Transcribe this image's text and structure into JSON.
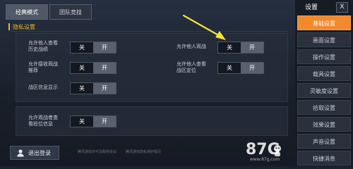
{
  "mode_tabs": [
    {
      "label": "经典模式",
      "active": true
    },
    {
      "label": "团队竞技",
      "active": false
    }
  ],
  "section": {
    "title": "隐私设置"
  },
  "options": [
    {
      "label_lines": [
        "允许他人查看",
        "历史战绩"
      ],
      "off": "关",
      "on": "开",
      "selected": "off"
    },
    {
      "label_lines": [
        "允许他人观战"
      ],
      "off": "关",
      "on": "开",
      "selected": "off"
    },
    {
      "label_lines": [
        "允许接收观战",
        "推荐"
      ],
      "off": "关",
      "on": "开",
      "selected": "off"
    },
    {
      "label_lines": [
        "允许他人查看",
        "战区定位"
      ],
      "off": "关",
      "on": "开",
      "selected": "off"
    },
    {
      "label_lines": [
        "战区信息显示"
      ],
      "off": "关",
      "on": "开",
      "selected": "off"
    },
    {
      "label_lines": [
        "允许观战者查",
        "看段位信息"
      ],
      "off": "关",
      "on": "开",
      "selected": "off"
    }
  ],
  "logout": {
    "label": "退出登录",
    "icon": "person-icon"
  },
  "footer": {
    "left": "腾讯游戏许可及服务协议",
    "right": "腾讯游戏隐私保护指引"
  },
  "sidebar": {
    "title": "设置",
    "close": "X",
    "items": [
      {
        "label": "基础设置",
        "active": true
      },
      {
        "label": "画面设置",
        "active": false
      },
      {
        "label": "操作设置",
        "active": false
      },
      {
        "label": "载具设置",
        "active": false
      },
      {
        "label": "灵敏度设置",
        "active": false
      },
      {
        "label": "拾取设置",
        "active": false
      },
      {
        "label": "效果设置",
        "active": false
      },
      {
        "label": "声音设置",
        "active": false
      },
      {
        "label": "快捷消息",
        "active": false
      }
    ]
  },
  "watermark": {
    "logo": "87G",
    "site": "www.87g.com"
  },
  "colors": {
    "accent": "#f2b12d",
    "active_tab": "#f28a2d",
    "arrow": "#f5e23a"
  }
}
